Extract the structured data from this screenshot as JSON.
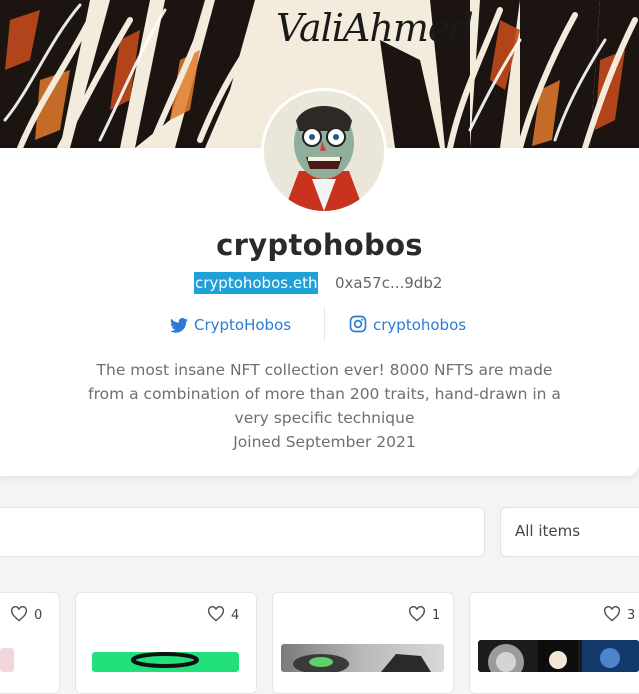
{
  "banner": {
    "signature": "ValiAhmed"
  },
  "profile": {
    "name": "cryptohobos",
    "ens": "cryptohobos.eth",
    "address": "0xa57c...9db2",
    "twitter": "CryptoHobos",
    "instagram": "cryptohobos",
    "bio_lines": [
      "The most insane NFT collection ever! 8000 NFTS are made",
      "from a combination of more than 200 traits, hand-drawn in a",
      "very specific technique"
    ],
    "joined": "Joined September 2021"
  },
  "filters": {
    "search_placeholder": "",
    "select_value": "All items"
  },
  "items": [
    {
      "likes": "0"
    },
    {
      "likes": "4"
    },
    {
      "likes": "1"
    },
    {
      "likes": "3"
    }
  ],
  "colors": {
    "accent": "#1ea0d8",
    "link": "#2b7bd6"
  }
}
